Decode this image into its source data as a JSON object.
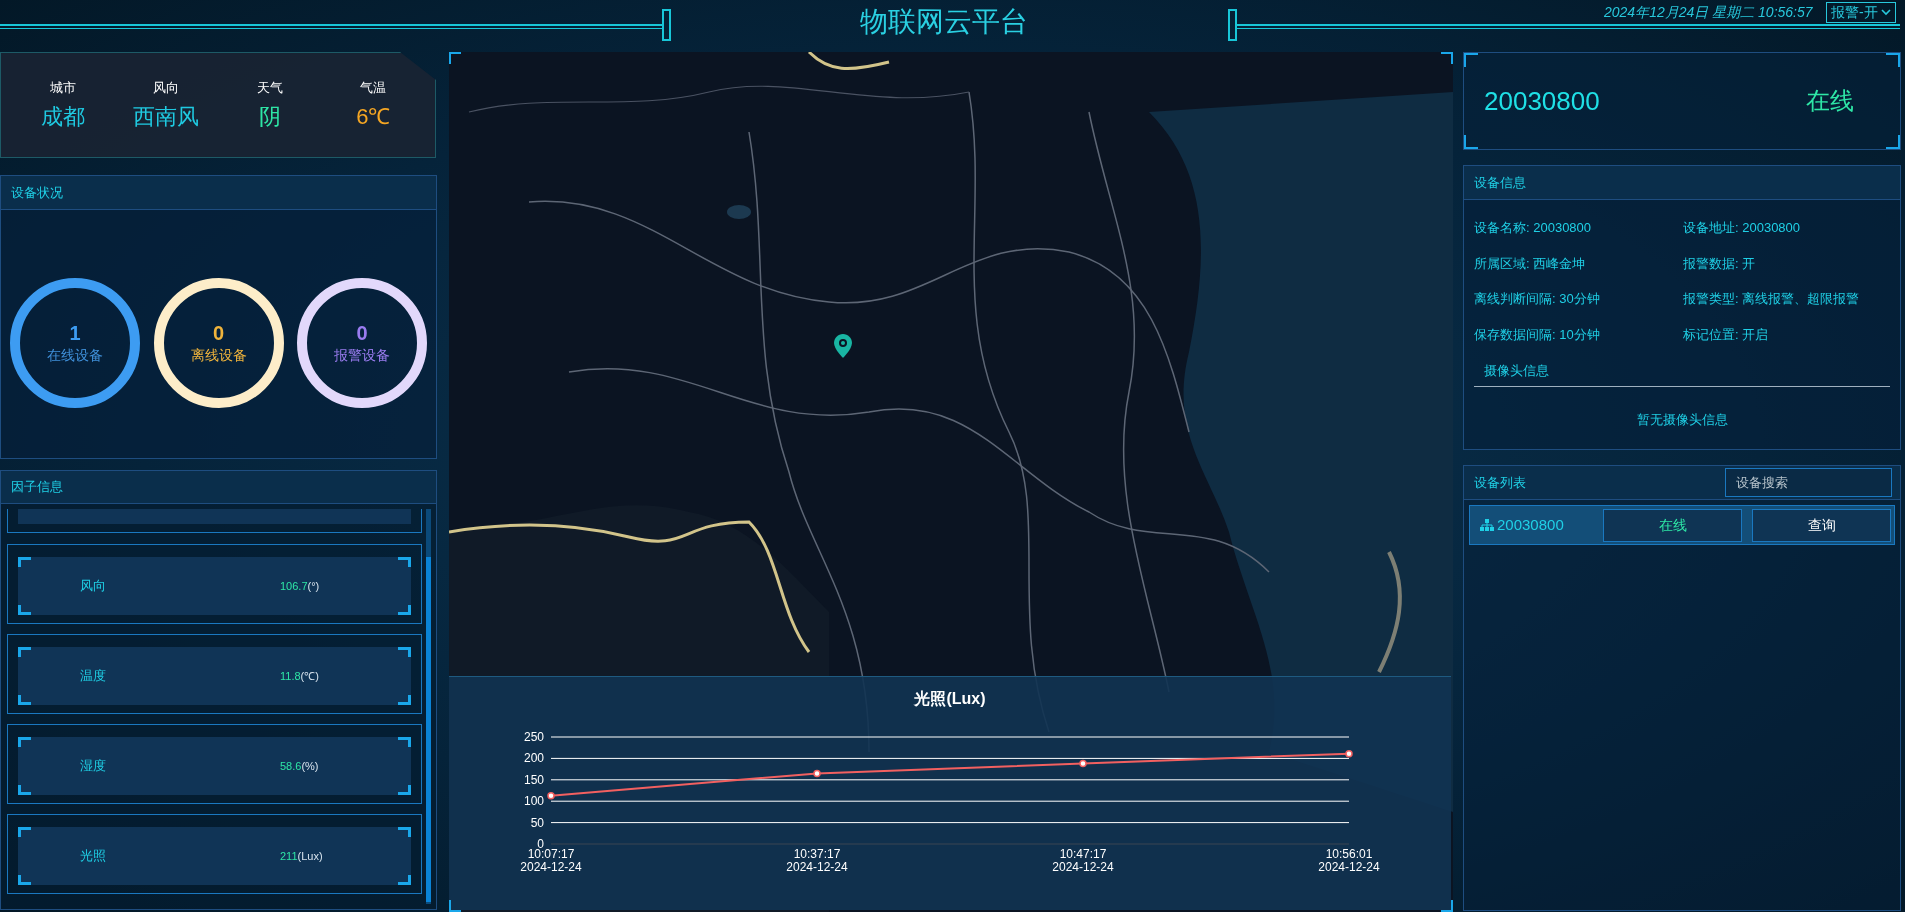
{
  "header": {
    "title": "物联网云平台",
    "datetime": "2024年12月24日 星期二 10:56:57",
    "alarm_select": "报警-开"
  },
  "weather": [
    {
      "label": "城市",
      "value": "成都",
      "color": "#1fc9e0"
    },
    {
      "label": "风向",
      "value": "西南风",
      "color": "#1fc9e0"
    },
    {
      "label": "天气",
      "value": "阴",
      "color": "#2ee6a6"
    },
    {
      "label": "气温",
      "value": "6℃",
      "color": "#f5a623"
    }
  ],
  "device_status": {
    "title": "设备状况",
    "items": [
      {
        "count": "1",
        "label": "在线设备",
        "color": "#3d9cf2"
      },
      {
        "count": "0",
        "label": "离线设备",
        "color": "#fdedc9"
      },
      {
        "count": "0",
        "label": "报警设备",
        "color": "#e2d8fb"
      }
    ]
  },
  "factors": {
    "title": "因子信息",
    "items": [
      {
        "name": "风向",
        "value": "106.7",
        "unit": "(°)"
      },
      {
        "name": "温度",
        "value": "11.8",
        "unit": "(℃)"
      },
      {
        "name": "湿度",
        "value": "58.6",
        "unit": "(%)"
      },
      {
        "name": "光照",
        "value": "211",
        "unit": "(Lux)"
      }
    ]
  },
  "chart": {
    "chart_data": {
      "type": "line",
      "title": "光照(Lux)",
      "categories": [
        "10:07:17\n2024-12-24",
        "10:37:17\n2024-12-24",
        "10:47:17\n2024-12-24",
        "10:56:01\n2024-12-24"
      ],
      "series": [
        {
          "color": "#f26060",
          "marker": "circle",
          "values": [
            113,
            165,
            188,
            211
          ]
        }
      ],
      "grid": true,
      "ylim": [
        0,
        250
      ],
      "yticks": [
        0,
        50,
        100,
        150,
        200,
        250
      ]
    }
  },
  "device": {
    "id": "20030800",
    "status": "在线"
  },
  "device_info": {
    "title": "设备信息",
    "fields": [
      {
        "label": "设备名称:",
        "value": "20030800"
      },
      {
        "label": "设备地址:",
        "value": "20030800"
      },
      {
        "label": "所属区域:",
        "value": "西峰金坤"
      },
      {
        "label": "报警数据:",
        "value": "开"
      },
      {
        "label": "离线判断间隔:",
        "value": "30分钟"
      },
      {
        "label": "报警类型:",
        "value": "离线报警、超限报警"
      },
      {
        "label": "保存数据间隔:",
        "value": "10分钟"
      },
      {
        "label": "标记位置:",
        "value": "开启"
      }
    ],
    "camera_tab": "摄像头信息",
    "camera_empty": "暂无摄像头信息"
  },
  "device_list": {
    "title": "设备列表",
    "search_placeholder": "设备搜索",
    "rows": [
      {
        "id": "20030800",
        "status": "在线",
        "action": "查询",
        "selected": true
      }
    ]
  }
}
